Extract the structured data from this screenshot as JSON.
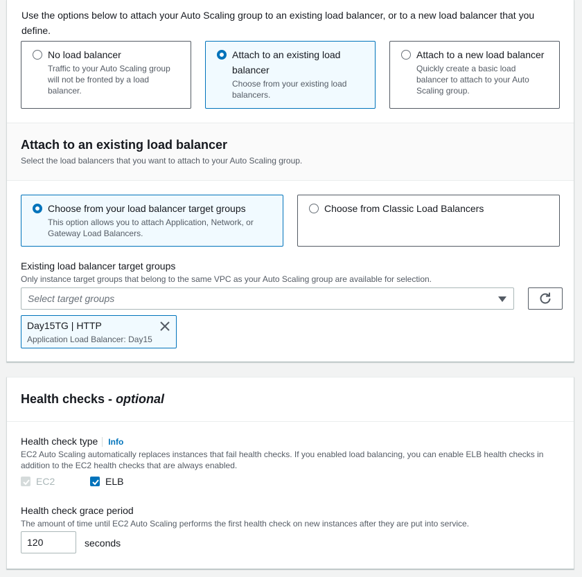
{
  "intro_text": "Use the options below to attach your Auto Scaling group to an existing load balancer, or to a new load balancer that you define.",
  "load_balancer_options": [
    {
      "title": "No load balancer",
      "desc": "Traffic to your Auto Scaling group will not be fronted by a load balancer.",
      "selected": false
    },
    {
      "title": "Attach to an existing load balancer",
      "desc": "Choose from your existing load balancers.",
      "selected": true
    },
    {
      "title": "Attach to a new load balancer",
      "desc": "Quickly create a basic load balancer to attach to your Auto Scaling group.",
      "selected": false
    }
  ],
  "existing_section": {
    "title": "Attach to an existing load balancer",
    "subtitle": "Select the load balancers that you want to attach to your Auto Scaling group."
  },
  "source_options": [
    {
      "title": "Choose from your load balancer target groups",
      "desc": "This option allows you to attach Application, Network, or Gateway Load Balancers.",
      "selected": true
    },
    {
      "title": "Choose from Classic Load Balancers",
      "desc": "",
      "selected": false
    }
  ],
  "target_groups": {
    "label": "Existing load balancer target groups",
    "desc": "Only instance target groups that belong to the same VPC as your Auto Scaling group are available for selection.",
    "placeholder": "Select target groups",
    "refresh_icon": "refresh-icon",
    "selected_token": {
      "title": "Day15TG | HTTP",
      "subtitle": "Application Load Balancer: Day15"
    }
  },
  "health_checks": {
    "title": "Health checks - ",
    "title_optional": "optional",
    "type_label": "Health check type",
    "info_link": "Info",
    "type_desc": "EC2 Auto Scaling automatically replaces instances that fail health checks. If you enabled load balancing, you can enable ELB health checks in addition to the EC2 health checks that are always enabled.",
    "ec2_label": "EC2",
    "elb_label": "ELB",
    "grace_label": "Health check grace period",
    "grace_desc": "The amount of time until EC2 Auto Scaling performs the first health check on new instances after they are put into service.",
    "grace_value": "120",
    "grace_unit": "seconds"
  },
  "colors": {
    "accent": "#0073bb",
    "text": "#16191f",
    "muted": "#545b64"
  }
}
